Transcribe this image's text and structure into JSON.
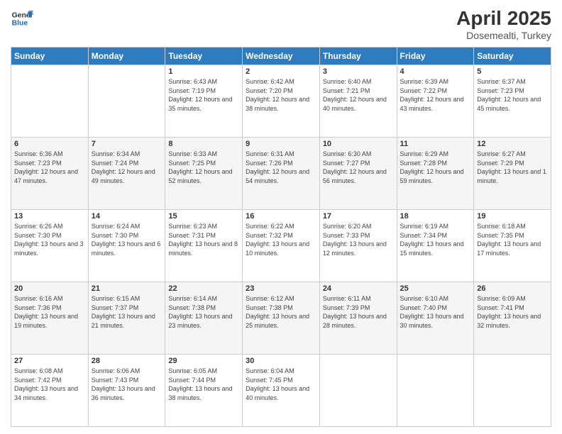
{
  "logo": {
    "line1": "General",
    "line2": "Blue"
  },
  "title": "April 2025",
  "location": "Dosemealti, Turkey",
  "days_of_week": [
    "Sunday",
    "Monday",
    "Tuesday",
    "Wednesday",
    "Thursday",
    "Friday",
    "Saturday"
  ],
  "weeks": [
    [
      {
        "day": "",
        "info": ""
      },
      {
        "day": "",
        "info": ""
      },
      {
        "day": "1",
        "info": "Sunrise: 6:43 AM\nSunset: 7:19 PM\nDaylight: 12 hours and 35 minutes."
      },
      {
        "day": "2",
        "info": "Sunrise: 6:42 AM\nSunset: 7:20 PM\nDaylight: 12 hours and 38 minutes."
      },
      {
        "day": "3",
        "info": "Sunrise: 6:40 AM\nSunset: 7:21 PM\nDaylight: 12 hours and 40 minutes."
      },
      {
        "day": "4",
        "info": "Sunrise: 6:39 AM\nSunset: 7:22 PM\nDaylight: 12 hours and 43 minutes."
      },
      {
        "day": "5",
        "info": "Sunrise: 6:37 AM\nSunset: 7:23 PM\nDaylight: 12 hours and 45 minutes."
      }
    ],
    [
      {
        "day": "6",
        "info": "Sunrise: 6:36 AM\nSunset: 7:23 PM\nDaylight: 12 hours and 47 minutes."
      },
      {
        "day": "7",
        "info": "Sunrise: 6:34 AM\nSunset: 7:24 PM\nDaylight: 12 hours and 49 minutes."
      },
      {
        "day": "8",
        "info": "Sunrise: 6:33 AM\nSunset: 7:25 PM\nDaylight: 12 hours and 52 minutes."
      },
      {
        "day": "9",
        "info": "Sunrise: 6:31 AM\nSunset: 7:26 PM\nDaylight: 12 hours and 54 minutes."
      },
      {
        "day": "10",
        "info": "Sunrise: 6:30 AM\nSunset: 7:27 PM\nDaylight: 12 hours and 56 minutes."
      },
      {
        "day": "11",
        "info": "Sunrise: 6:29 AM\nSunset: 7:28 PM\nDaylight: 12 hours and 59 minutes."
      },
      {
        "day": "12",
        "info": "Sunrise: 6:27 AM\nSunset: 7:29 PM\nDaylight: 13 hours and 1 minute."
      }
    ],
    [
      {
        "day": "13",
        "info": "Sunrise: 6:26 AM\nSunset: 7:30 PM\nDaylight: 13 hours and 3 minutes."
      },
      {
        "day": "14",
        "info": "Sunrise: 6:24 AM\nSunset: 7:30 PM\nDaylight: 13 hours and 6 minutes."
      },
      {
        "day": "15",
        "info": "Sunrise: 6:23 AM\nSunset: 7:31 PM\nDaylight: 13 hours and 8 minutes."
      },
      {
        "day": "16",
        "info": "Sunrise: 6:22 AM\nSunset: 7:32 PM\nDaylight: 13 hours and 10 minutes."
      },
      {
        "day": "17",
        "info": "Sunrise: 6:20 AM\nSunset: 7:33 PM\nDaylight: 13 hours and 12 minutes."
      },
      {
        "day": "18",
        "info": "Sunrise: 6:19 AM\nSunset: 7:34 PM\nDaylight: 13 hours and 15 minutes."
      },
      {
        "day": "19",
        "info": "Sunrise: 6:18 AM\nSunset: 7:35 PM\nDaylight: 13 hours and 17 minutes."
      }
    ],
    [
      {
        "day": "20",
        "info": "Sunrise: 6:16 AM\nSunset: 7:36 PM\nDaylight: 13 hours and 19 minutes."
      },
      {
        "day": "21",
        "info": "Sunrise: 6:15 AM\nSunset: 7:37 PM\nDaylight: 13 hours and 21 minutes."
      },
      {
        "day": "22",
        "info": "Sunrise: 6:14 AM\nSunset: 7:38 PM\nDaylight: 13 hours and 23 minutes."
      },
      {
        "day": "23",
        "info": "Sunrise: 6:12 AM\nSunset: 7:38 PM\nDaylight: 13 hours and 25 minutes."
      },
      {
        "day": "24",
        "info": "Sunrise: 6:11 AM\nSunset: 7:39 PM\nDaylight: 13 hours and 28 minutes."
      },
      {
        "day": "25",
        "info": "Sunrise: 6:10 AM\nSunset: 7:40 PM\nDaylight: 13 hours and 30 minutes."
      },
      {
        "day": "26",
        "info": "Sunrise: 6:09 AM\nSunset: 7:41 PM\nDaylight: 13 hours and 32 minutes."
      }
    ],
    [
      {
        "day": "27",
        "info": "Sunrise: 6:08 AM\nSunset: 7:42 PM\nDaylight: 13 hours and 34 minutes."
      },
      {
        "day": "28",
        "info": "Sunrise: 6:06 AM\nSunset: 7:43 PM\nDaylight: 13 hours and 36 minutes."
      },
      {
        "day": "29",
        "info": "Sunrise: 6:05 AM\nSunset: 7:44 PM\nDaylight: 13 hours and 38 minutes."
      },
      {
        "day": "30",
        "info": "Sunrise: 6:04 AM\nSunset: 7:45 PM\nDaylight: 13 hours and 40 minutes."
      },
      {
        "day": "",
        "info": ""
      },
      {
        "day": "",
        "info": ""
      },
      {
        "day": "",
        "info": ""
      }
    ]
  ]
}
